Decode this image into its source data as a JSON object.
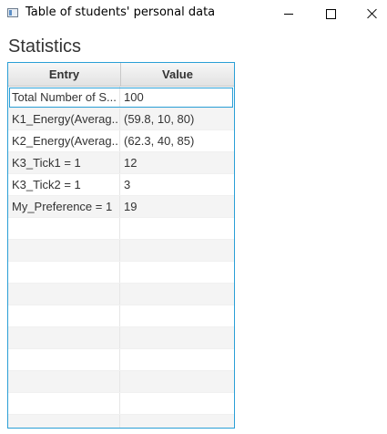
{
  "window": {
    "title": "Table of students' personal data"
  },
  "page": {
    "heading": "Statistics"
  },
  "table": {
    "columns": [
      "Entry",
      "Value"
    ],
    "rows": [
      {
        "entry": "Total Number of S...",
        "value": "100"
      },
      {
        "entry": "K1_Energy(Averag...",
        "value": "(59.8, 10, 80)"
      },
      {
        "entry": "K2_Energy(Averag...",
        "value": "(62.3, 40, 85)"
      },
      {
        "entry": "K3_Tick1 = 1",
        "value": "12"
      },
      {
        "entry": "K3_Tick2 = 1",
        "value": "3"
      },
      {
        "entry": "My_Preference = 1",
        "value": "19"
      }
    ],
    "selected_row": 0
  },
  "colors": {
    "accent": "#2a9fd6",
    "stripe": "#f4f4f4"
  }
}
